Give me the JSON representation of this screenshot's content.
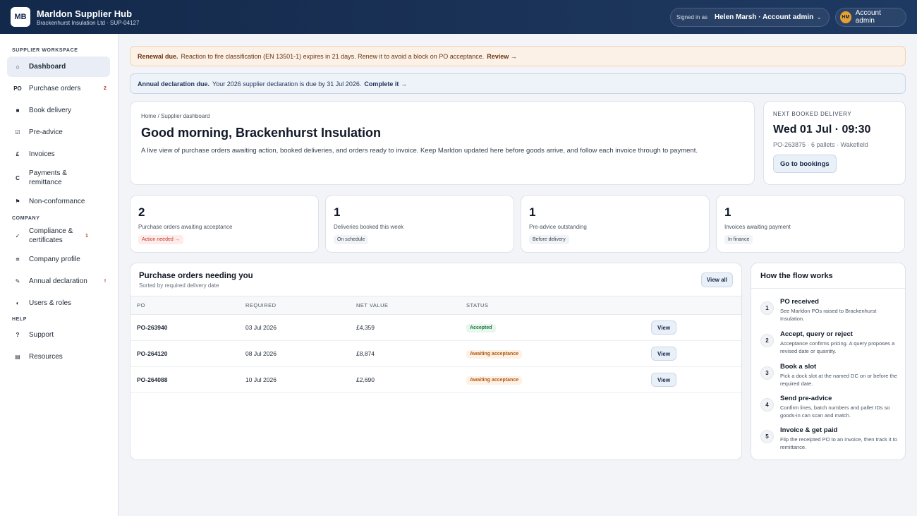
{
  "header": {
    "logo": "MB",
    "title": "Marldon Supplier Hub",
    "subtitle": "Brackenhurst Insulation Ltd · SUP-04127",
    "signed_in_label": "Signed in as",
    "signed_in_user": "Helen Marsh · Account admin",
    "avatar_initials": "HM",
    "account_label": "Account admin"
  },
  "sidebar": {
    "sections": [
      {
        "title": "Supplier workspace"
      },
      {
        "title": "Company"
      },
      {
        "title": "Help"
      }
    ],
    "workspace_items": [
      {
        "icon": "home-icon",
        "glyph": "⌂",
        "label": "Dashboard",
        "badge": ""
      },
      {
        "icon": "po-icon",
        "glyph": "PO",
        "label": "Purchase orders",
        "badge": "2"
      },
      {
        "icon": "truck-icon",
        "glyph": "■",
        "label": "Book delivery",
        "badge": ""
      },
      {
        "icon": "checklist-icon",
        "glyph": "☑",
        "label": "Pre-advice",
        "badge": ""
      },
      {
        "icon": "pound-icon",
        "glyph": "£",
        "label": "Invoices",
        "badge": ""
      },
      {
        "icon": "payment-icon",
        "glyph": "C",
        "label": "Payments & remittance",
        "badge": ""
      },
      {
        "icon": "flag-icon",
        "glyph": "⚑",
        "label": "Non-conformance",
        "badge": ""
      }
    ],
    "company_items": [
      {
        "icon": "check-icon",
        "glyph": "✓",
        "label": "Compliance & certificates",
        "badge": "1"
      },
      {
        "icon": "grid-icon",
        "glyph": "⌗",
        "label": "Company profile",
        "badge": ""
      },
      {
        "icon": "pen-icon",
        "glyph": "✎",
        "label": "Annual declaration",
        "badge": "!"
      },
      {
        "icon": "users-icon",
        "glyph": "◐",
        "label": "Users & roles",
        "badge": ""
      }
    ],
    "help_items": [
      {
        "icon": "question-icon",
        "glyph": "?",
        "label": "Support",
        "badge": ""
      },
      {
        "icon": "book-icon",
        "glyph": "▤",
        "label": "Resources",
        "badge": ""
      }
    ]
  },
  "banners": {
    "renewal": {
      "strong": "Renewal due.",
      "text": "Reaction to fire classification (EN 13501-1) expires in 21 days. Renew it to avoid a block on PO acceptance.",
      "link": "Review →"
    },
    "declaration": {
      "strong": "Annual declaration due.",
      "text": "Your 2026 supplier declaration is due by 31 Jul 2026.",
      "link": "Complete it →"
    }
  },
  "hero": {
    "breadcrumb": "Home / Supplier dashboard",
    "title": "Good morning, Brackenhurst Insulation",
    "description": "A live view of purchase orders awaiting action, booked deliveries, and orders ready to invoice. Keep Marldon updated here before goods arrive, and follow each invoice through to payment."
  },
  "next_delivery": {
    "label": "Next booked delivery",
    "datetime": "Wed 01 Jul · 09:30",
    "meta": "PO-263875 · 6 pallets · Wakefield",
    "button": "Go to bookings"
  },
  "stats": [
    {
      "value": "2",
      "caption": "Purchase orders awaiting acceptance",
      "chip": "Action needed →",
      "chip_style": "danger"
    },
    {
      "value": "1",
      "caption": "Deliveries booked this week",
      "chip": "On schedule",
      "chip_style": "neutral"
    },
    {
      "value": "1",
      "caption": "Pre-advice outstanding",
      "chip": "Before delivery",
      "chip_style": "neutral"
    },
    {
      "value": "1",
      "caption": "Invoices awaiting payment",
      "chip": "In finance",
      "chip_style": "neutral"
    }
  ],
  "orders": {
    "title": "Purchase orders needing you",
    "subtitle": "Sorted by required delivery date",
    "view_all": "View all",
    "columns": [
      "PO",
      "REQUIRED",
      "NET VALUE",
      "STATUS"
    ],
    "rows": [
      {
        "po": "PO-263940",
        "required": "03 Jul 2026",
        "net": "£4,359",
        "status": "Accepted",
        "status_style": "accepted",
        "action": "View"
      },
      {
        "po": "PO-264120",
        "required": "08 Jul 2026",
        "net": "£8,874",
        "status": "Awaiting acceptance",
        "status_style": "awaiting",
        "action": "View"
      },
      {
        "po": "PO-264088",
        "required": "10 Jul 2026",
        "net": "£2,690",
        "status": "Awaiting acceptance",
        "status_style": "awaiting",
        "action": "View"
      }
    ]
  },
  "flow": {
    "title": "How the flow works",
    "steps": [
      {
        "n": "1",
        "title": "PO received",
        "desc": "See Marldon POs raised to Brackenhurst Insulation."
      },
      {
        "n": "2",
        "title": "Accept, query or reject",
        "desc": "Acceptance confirms pricing. A query proposes a revised date or quantity."
      },
      {
        "n": "3",
        "title": "Book a slot",
        "desc": "Pick a dock slot at the named DC on or before the required date."
      },
      {
        "n": "4",
        "title": "Send pre-advice",
        "desc": "Confirm lines, batch numbers and pallet IDs so goods-in can scan and match."
      },
      {
        "n": "5",
        "title": "Invoice & get paid",
        "desc": "Flip the receipted PO to an invoice, then track it to remittance."
      }
    ]
  },
  "colors": {
    "topbar": "#13294b",
    "accent": "#1d3557",
    "danger": "#c0392b",
    "success": "#1e7a44",
    "warning": "#b25a12"
  }
}
